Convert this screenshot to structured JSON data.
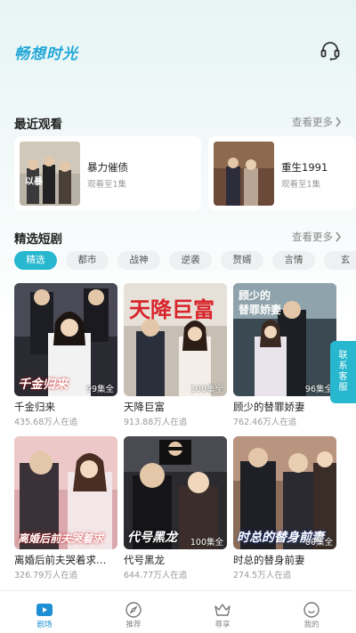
{
  "header": {
    "brand": "畅想时光",
    "support_icon": "headset-icon"
  },
  "recent": {
    "title": "最近观看",
    "more": "查看更多",
    "items": [
      {
        "title": "暴力催债",
        "progress": "观看至1集"
      },
      {
        "title": "重生1991",
        "progress": "观看至1集"
      }
    ]
  },
  "featured": {
    "title": "精选短剧",
    "more": "查看更多",
    "tabs": [
      "精选",
      "都市",
      "战神",
      "逆袭",
      "赘婿",
      "言情",
      "玄"
    ],
    "active_tab": "精选",
    "items": [
      {
        "title": "千金归来",
        "sub": "435.68万人在追",
        "episodes": "99集全",
        "poster_text": "千金归来"
      },
      {
        "title": "天降巨富",
        "sub": "913.88万人在追",
        "episodes": "100集全",
        "poster_text": "天降巨富"
      },
      {
        "title": "顾少的替罪娇妻",
        "sub": "762.46万人在追",
        "episodes": "96集全",
        "poster_text": "顾少的替罪娇妻"
      },
      {
        "title": "离婚后前夫哭着求…",
        "sub": "326.79万人在追",
        "episodes": "",
        "poster_text": "离婚后前夫哭着求"
      },
      {
        "title": "代号黑龙",
        "sub": "644.77万人在追",
        "episodes": "100集全",
        "poster_text": "代号黑龙"
      },
      {
        "title": "时总的替身前妻",
        "sub": "274.5万人在追",
        "episodes": "80集全",
        "poster_text": "时总的替身前妻"
      }
    ]
  },
  "service": {
    "chars": [
      "联",
      "系",
      "客",
      "服"
    ]
  },
  "nav": {
    "items": [
      {
        "label": "剧场",
        "icon": "theater-icon"
      },
      {
        "label": "推荐",
        "icon": "compass-icon"
      },
      {
        "label": "尊享",
        "icon": "crown-icon"
      },
      {
        "label": "我的",
        "icon": "profile-icon"
      }
    ],
    "active": "剧场"
  },
  "colors": {
    "accent": "#27b7cf",
    "nav_active": "#1f8fd3",
    "brand": "#22a7d8"
  }
}
